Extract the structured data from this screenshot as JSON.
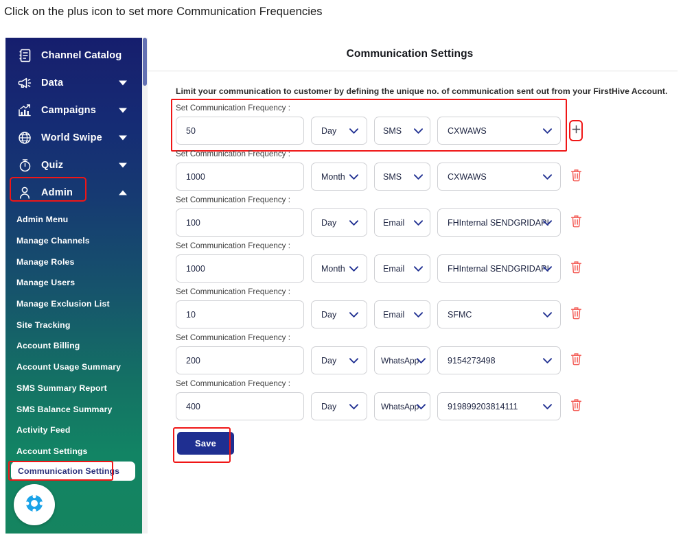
{
  "instruction": "Click on the plus icon to set more Communication Frequencies",
  "header": {
    "title": "Communication Settings"
  },
  "main": {
    "lead": "Limit your communication to customer by defining the unique no. of communication sent out from your FirstHive Account.",
    "row_label": "Set Communication Frequency :",
    "save_label": "Save",
    "add_icon": "plus-icon",
    "delete_icon": "trash-icon"
  },
  "sidebar": {
    "items": [
      {
        "label": "Channel Catalog",
        "icon": "catalog-icon",
        "caret": "none"
      },
      {
        "label": "Data",
        "icon": "megaphone-icon",
        "caret": "down"
      },
      {
        "label": "Campaigns",
        "icon": "chart-arrow-icon",
        "caret": "down"
      },
      {
        "label": "World Swipe",
        "icon": "globe-icon",
        "caret": "down"
      },
      {
        "label": "Quiz",
        "icon": "stopwatch-icon",
        "caret": "down"
      },
      {
        "label": "Admin",
        "icon": "user-icon",
        "caret": "up"
      }
    ],
    "sub_items": [
      {
        "label": "Admin Menu",
        "active": false
      },
      {
        "label": "Manage Channels",
        "active": false
      },
      {
        "label": "Manage Roles",
        "active": false
      },
      {
        "label": "Manage Users",
        "active": false
      },
      {
        "label": "Manage Exclusion List",
        "active": false
      },
      {
        "label": "Site Tracking",
        "active": false
      },
      {
        "label": "Account Billing",
        "active": false
      },
      {
        "label": "Account Usage Summary",
        "active": false
      },
      {
        "label": "SMS Summary Report",
        "active": false
      },
      {
        "label": "SMS Balance Summary",
        "active": false
      },
      {
        "label": "Activity Feed",
        "active": false
      },
      {
        "label": "Account Settings",
        "active": false
      },
      {
        "label": "Communication Settings",
        "active": true
      }
    ],
    "support_icon": "lifebuoy-icon"
  },
  "frequencies": [
    {
      "count": "50",
      "period": "Day",
      "channel": "SMS",
      "provider": "CXWAWS",
      "action": "add",
      "highlighted": true
    },
    {
      "count": "1000",
      "period": "Month",
      "channel": "SMS",
      "provider": "CXWAWS",
      "action": "delete",
      "highlighted": false
    },
    {
      "count": "100",
      "period": "Day",
      "channel": "Email",
      "provider": "FHInternal SENDGRIDAPI",
      "action": "delete",
      "highlighted": false
    },
    {
      "count": "1000",
      "period": "Month",
      "channel": "Email",
      "provider": "FHInternal SENDGRIDAPI",
      "action": "delete",
      "highlighted": false
    },
    {
      "count": "10",
      "period": "Day",
      "channel": "Email",
      "provider": "SFMC",
      "action": "delete",
      "highlighted": false
    },
    {
      "count": "200",
      "period": "Day",
      "channel": "WhatsApp",
      "provider": "9154273498",
      "action": "delete",
      "highlighted": false
    },
    {
      "count": "400",
      "period": "Day",
      "channel": "WhatsApp",
      "provider": "919899203814111",
      "action": "delete",
      "highlighted": false
    }
  ],
  "colors": {
    "sidebar_top": "#151e6e",
    "sidebar_bottom": "#15845f",
    "highlight": "#f01616",
    "primary": "#1f2f91",
    "delete": "#f4625c"
  }
}
